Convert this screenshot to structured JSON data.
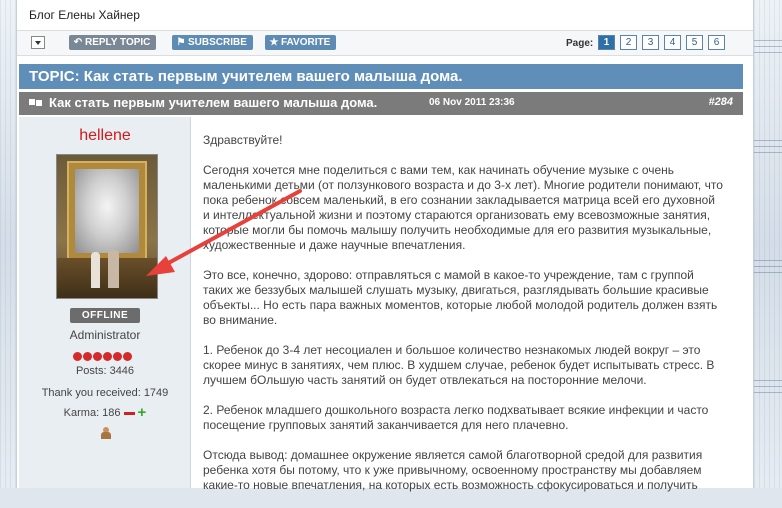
{
  "blog_title": "Блог Елены Хайнер",
  "toolbar": {
    "reply_label": "REPLY TOPIC",
    "subscribe_label": "SUBSCRIBE",
    "favorite_label": "FAVORITE",
    "page_label": "Page:",
    "pages": [
      "1",
      "2",
      "3",
      "4",
      "5",
      "6"
    ],
    "current_page": "1"
  },
  "topic_bar": "TOPIC: Как стать первым учителем вашего малыша дома.",
  "post": {
    "title": "Как стать первым учителем вашего малыша дома.",
    "date": "06 Nov 2011 23:36",
    "number": "#284",
    "paragraphs": [
      "Здравствуйте!",
      "Сегодня хочется мне поделиться с вами тем, как начинать обучение музыке с очень маленькими детьми (от ползункового возраста и до 3-х лет). Многие родители понимают, что пока ребенок совсем маленький, в его сознании закладывается матрица всей его духовной и интеллектуальной жизни и поэтому стараются организовать ему всевозможные занятия, которые могли бы помочь малышу получить необходимые для его развития музыкальные, художественные и даже научные впечатления.",
      "Это все, конечно, здорово: отправляться с мамой в какое-то учреждение, там с группой таких же беззубых малышей слушать музыку, двигаться, разглядывать большие красивые объекты... Но есть пара важных моментов, которые любой молодой родитель должен взять во внимание.",
      "1. Ребенок до 3-4 лет несоциален и большое количество незнакомых людей вокруг – это скорее минус в занятиях, чем плюс. В худшем случае, ребенок будет испытывать стресс. В лучшем бОльшую часть занятий он будет отвлекаться на посторонние мелочи.",
      "2. Ребенок младшего дошкольного возраста легко подхватывает всякие инфекции и часто посещение групповых занятий заканчивается для него плачевно.",
      "Отсюда вывод: домашнее окружение является самой благотворной средой для развития ребенка хотя бы потому, что к уже привычному, освоенному пространству мы добавляем какие-то новые впечатления, на которых есть возможность сфокусироваться и получить"
    ]
  },
  "author": {
    "name": "hellene",
    "status": "OFFLINE",
    "role": "Administrator",
    "rank_dots": 6,
    "posts": "Posts: 3446",
    "thanks": "Thank you received: 1749",
    "karma": "Karma: 186"
  },
  "colors": {
    "topic_bar": "#5f8fb9",
    "post_header": "#7b7b7b",
    "username": "#d11a1a",
    "arrow": "#e8403a"
  }
}
